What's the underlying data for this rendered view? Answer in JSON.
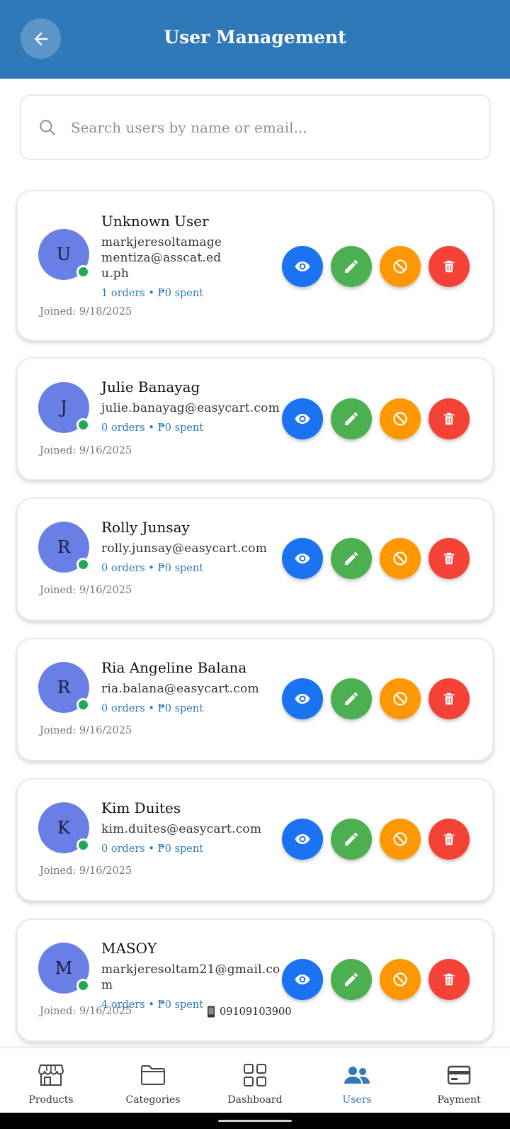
{
  "header": {
    "title": "User Management"
  },
  "search": {
    "placeholder": "Search users by name or email..."
  },
  "colors": {
    "brand": "#2f79b9",
    "view": "#1a73f0",
    "edit": "#4caf50",
    "block": "#ff9800",
    "delete": "#f44336",
    "avatar": "#6a7fe6",
    "online": "#22a855"
  },
  "users": [
    {
      "initial": "U",
      "name": "Unknown User",
      "email": "markjeresoltamagementiza@asscat.edu.ph",
      "stats": "1 orders • ₱0 spent",
      "joined": "Joined: 9/18/2025"
    },
    {
      "initial": "J",
      "name": "Julie Banayag",
      "email": "julie.banayag@easycart.com",
      "stats": "0 orders • ₱0 spent",
      "joined": "Joined: 9/16/2025"
    },
    {
      "initial": "R",
      "name": "Rolly Junsay",
      "email": "rolly.junsay@easycart.com",
      "stats": "0 orders • ₱0 spent",
      "joined": "Joined: 9/16/2025"
    },
    {
      "initial": "R",
      "name": "Ria Angeline Balana",
      "email": "ria.balana@easycart.com",
      "stats": "0 orders • ₱0 spent",
      "joined": "Joined: 9/16/2025"
    },
    {
      "initial": "K",
      "name": "Kim Duites",
      "email": "kim.duites@easycart.com",
      "stats": "0 orders • ₱0 spent",
      "joined": "Joined: 9/16/2025"
    },
    {
      "initial": "M",
      "name": "MASOY",
      "email": "markjeresoltam21@gmail.com",
      "stats": "4 orders • ₱0 spent",
      "joined": "Joined: 9/16/2025",
      "phone": "09109103900"
    }
  ],
  "nav": [
    {
      "label": "Products",
      "icon": "store-icon"
    },
    {
      "label": "Categories",
      "icon": "folder-icon"
    },
    {
      "label": "Dashboard",
      "icon": "grid-icon"
    },
    {
      "label": "Users",
      "icon": "users-icon",
      "active": true
    },
    {
      "label": "Payment",
      "icon": "card-icon"
    }
  ]
}
